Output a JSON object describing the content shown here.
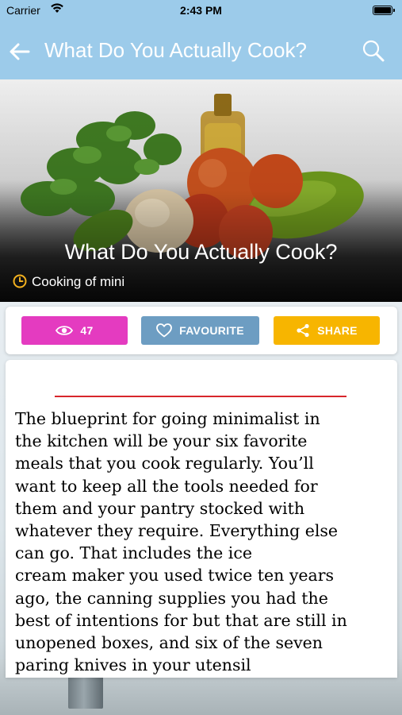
{
  "status_bar": {
    "carrier": "Carrier",
    "time": "2:43 PM"
  },
  "nav_bar": {
    "title": "What Do You Actually Cook?",
    "back_icon": "arrow-left-icon",
    "search_icon": "search-icon",
    "background_color": "#9ccbea"
  },
  "hero": {
    "title": "What Do You Actually Cook?",
    "meta_icon": "clock-icon",
    "meta_text": "Cooking of mini"
  },
  "actions": {
    "views": {
      "icon": "eye-icon",
      "label": "47",
      "color": "#e43bc0"
    },
    "favourite": {
      "icon": "heart-icon",
      "label": "FAVOURITE",
      "color": "#6d9dc2"
    },
    "share": {
      "icon": "share-icon",
      "label": "SHARE",
      "color": "#f7b500"
    }
  },
  "article": {
    "rule_color": "#d8262b",
    "lines": [
      "The blueprint for going minimalist in",
      "the kitchen will be your six favorite",
      "meals that you cook regularly. You’ll",
      "want to keep all the tools needed for",
      "them and your pantry stocked with",
      "whatever they require. Everything else",
      "can go. That includes the ice",
      "cream maker you used twice ten years",
      "ago, the canning supplies you had the",
      "best of intentions for but that are still in",
      "unopened boxes, and six of the seven",
      "paring knives in your utensil"
    ]
  }
}
